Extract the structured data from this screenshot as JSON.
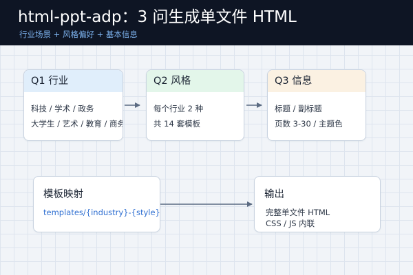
{
  "header": {
    "title": "html-ppt-adp：3 问生成单文件 HTML",
    "subtitle": "行业场景 + 风格偏好 + 基本信息"
  },
  "questions": [
    {
      "title": "Q1 行业",
      "lines": [
        "科技 / 学术 / 政务",
        "大学生 / 艺术 / 教育 / 商务"
      ],
      "header_color": "#e0eefb"
    },
    {
      "title": "Q2 风格",
      "lines": [
        "每个行业 2 种",
        "共 14 套模板"
      ],
      "header_color": "#e3f6ea"
    },
    {
      "title": "Q3 信息",
      "lines": [
        "标题 / 副标题",
        "页数 3-30 / 主题色"
      ],
      "header_color": "#fbf1e2"
    }
  ],
  "mapping": {
    "title": "模板映射",
    "path": "templates/{industry}-{style}.html"
  },
  "output": {
    "title": "输出",
    "lines": [
      "完整单文件 HTML",
      "CSS / JS 内联"
    ]
  },
  "colors": {
    "header_bg": "#0e1524",
    "subtitle": "#7db3ef",
    "arrow": "#5b6b82",
    "link": "#2f6fd1"
  }
}
